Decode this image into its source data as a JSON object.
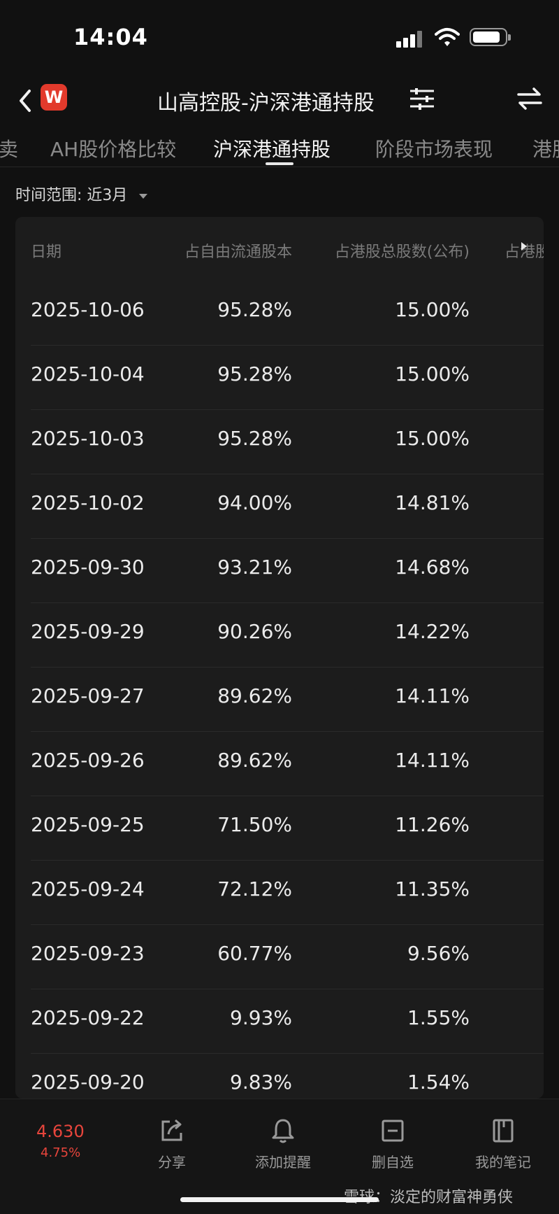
{
  "status_bar": {
    "time": "14:04"
  },
  "nav": {
    "logo_letter": "W",
    "title": "山高控股-沪深港通持股"
  },
  "tabs": [
    {
      "label": "卖",
      "active": false
    },
    {
      "label": "AH股价格比较",
      "active": false
    },
    {
      "label": "沪深港通持股",
      "active": true
    },
    {
      "label": "阶段市场表现",
      "active": false
    },
    {
      "label": "港股",
      "active": false
    }
  ],
  "filter": {
    "label": "时间范围:",
    "value": "近3月"
  },
  "table": {
    "headers": [
      "日期",
      "占自由流通股本",
      "占港股总股数(公布)",
      "占港股"
    ],
    "rows": [
      [
        "2025-10-06",
        "95.28%",
        "15.00%"
      ],
      [
        "2025-10-04",
        "95.28%",
        "15.00%"
      ],
      [
        "2025-10-03",
        "95.28%",
        "15.00%"
      ],
      [
        "2025-10-02",
        "94.00%",
        "14.81%"
      ],
      [
        "2025-09-30",
        "93.21%",
        "14.68%"
      ],
      [
        "2025-09-29",
        "90.26%",
        "14.22%"
      ],
      [
        "2025-09-27",
        "89.62%",
        "14.11%"
      ],
      [
        "2025-09-26",
        "89.62%",
        "14.11%"
      ],
      [
        "2025-09-25",
        "71.50%",
        "11.26%"
      ],
      [
        "2025-09-24",
        "72.12%",
        "11.35%"
      ],
      [
        "2025-09-23",
        "60.77%",
        "9.56%"
      ],
      [
        "2025-09-22",
        "9.93%",
        "1.55%"
      ],
      [
        "2025-09-20",
        "9.83%",
        "1.54%"
      ]
    ]
  },
  "bottom_bar": {
    "price": "4.630",
    "change_pct": "4.75%",
    "items": [
      {
        "label": "分享",
        "icon": "share-icon"
      },
      {
        "label": "添加提醒",
        "icon": "bell-icon"
      },
      {
        "label": "删自选",
        "icon": "remove-watchlist-icon"
      },
      {
        "label": "我的笔记",
        "icon": "notebook-icon"
      }
    ],
    "watermark": "雪球：淡定的财富神勇侠"
  },
  "colors": {
    "accent_red": "#e8453c",
    "background": "#111111",
    "card": "#1c1c1c"
  }
}
